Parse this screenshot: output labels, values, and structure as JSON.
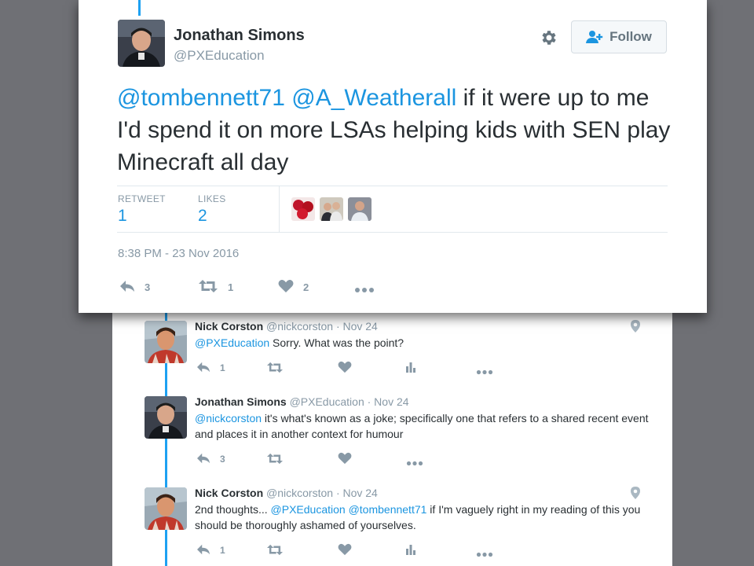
{
  "main_tweet": {
    "author_name": "Jonathan Simons",
    "author_handle": "@PXEducation",
    "follow_label": "Follow",
    "mention1": "@tombennett71",
    "mention2": "@A_Weatherall",
    "text": " if it were up to me I'd spend it on more LSAs helping kids with SEN play Minecraft all day",
    "stats": {
      "retweet_label": "RETWEET",
      "retweet_count": "1",
      "likes_label": "LIKES",
      "likes_count": "2"
    },
    "timestamp": "8:38 PM - 23 Nov 2016",
    "actions": {
      "reply_count": "3",
      "retweet_count": "1",
      "like_count": "2"
    }
  },
  "replies": [
    {
      "name": "Nick Corston",
      "handle": "@nickcorston",
      "date": "· Nov 24",
      "mention": "@PXEducation",
      "text": " Sorry. What was the point?",
      "reply_count": "1"
    },
    {
      "name": "Jonathan Simons",
      "handle": "@PXEducation",
      "date": "· Nov 24",
      "mention": "@nickcorston",
      "text": " it's what's known as a joke; specifically one that refers to a shared recent event and places it in another context for humour",
      "reply_count": "3"
    },
    {
      "name": "Nick Corston",
      "handle": "@nickcorston",
      "date": "· Nov 24",
      "prefix": "2nd thoughts... ",
      "mention": "@PXEducation",
      "mention2": "@tombennett71",
      "text": " if I'm vaguely right in my reading of this you should be thoroughly ashamed of yourselves.",
      "reply_count": "1"
    }
  ],
  "colors": {
    "link": "#1b95e0",
    "thread": "#1da1f2",
    "icon": "#8899a6",
    "background": "#6f7075"
  },
  "icons": [
    "gear-icon",
    "follow-person-icon",
    "reply-icon",
    "retweet-icon",
    "like-icon",
    "more-icon",
    "analytics-icon",
    "location-icon"
  ]
}
